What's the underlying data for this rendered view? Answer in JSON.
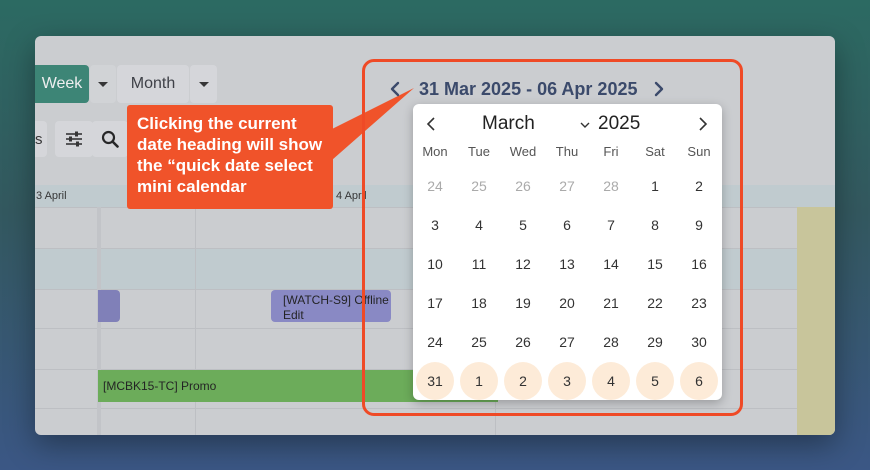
{
  "toolbar": {
    "week_label": "Week",
    "month_label": "Month",
    "truncated_label": "s"
  },
  "grid": {
    "day_headers": [
      "3 April",
      "4 April"
    ],
    "events": [
      {
        "id": "purple1",
        "label": ""
      },
      {
        "id": "purple2",
        "label": "[WATCH-S9] Offline Edit"
      },
      {
        "id": "green",
        "label": "[MCBK15-TC] Promo"
      }
    ]
  },
  "callout": {
    "text": "Clicking the current date heading will show the “quick date select mini calendar"
  },
  "heading": {
    "date_range": "31 Mar 2025 - 06 Apr 2025"
  },
  "mini_calendar": {
    "month": "March",
    "year": "2025",
    "weekdays": [
      "Mon",
      "Tue",
      "Wed",
      "Thu",
      "Fri",
      "Sat",
      "Sun"
    ],
    "weeks": [
      [
        "24",
        "25",
        "26",
        "27",
        "28",
        "1",
        "2"
      ],
      [
        "3",
        "4",
        "5",
        "6",
        "7",
        "8",
        "9"
      ],
      [
        "10",
        "11",
        "12",
        "13",
        "14",
        "15",
        "16"
      ],
      [
        "17",
        "18",
        "19",
        "20",
        "21",
        "22",
        "23"
      ],
      [
        "24",
        "25",
        "26",
        "27",
        "28",
        "29",
        "30"
      ],
      [
        "31",
        "1",
        "2",
        "3",
        "4",
        "5",
        "6"
      ]
    ],
    "muted_cells": [
      [
        0,
        0
      ],
      [
        0,
        1
      ],
      [
        0,
        2
      ],
      [
        0,
        3
      ],
      [
        0,
        4
      ]
    ],
    "selected_week_index": 5
  },
  "colors": {
    "accent": "#3a8b79",
    "callout": "#f0532a",
    "selected_day": "#fdebd8",
    "heading_text": "#3b4a6b"
  }
}
